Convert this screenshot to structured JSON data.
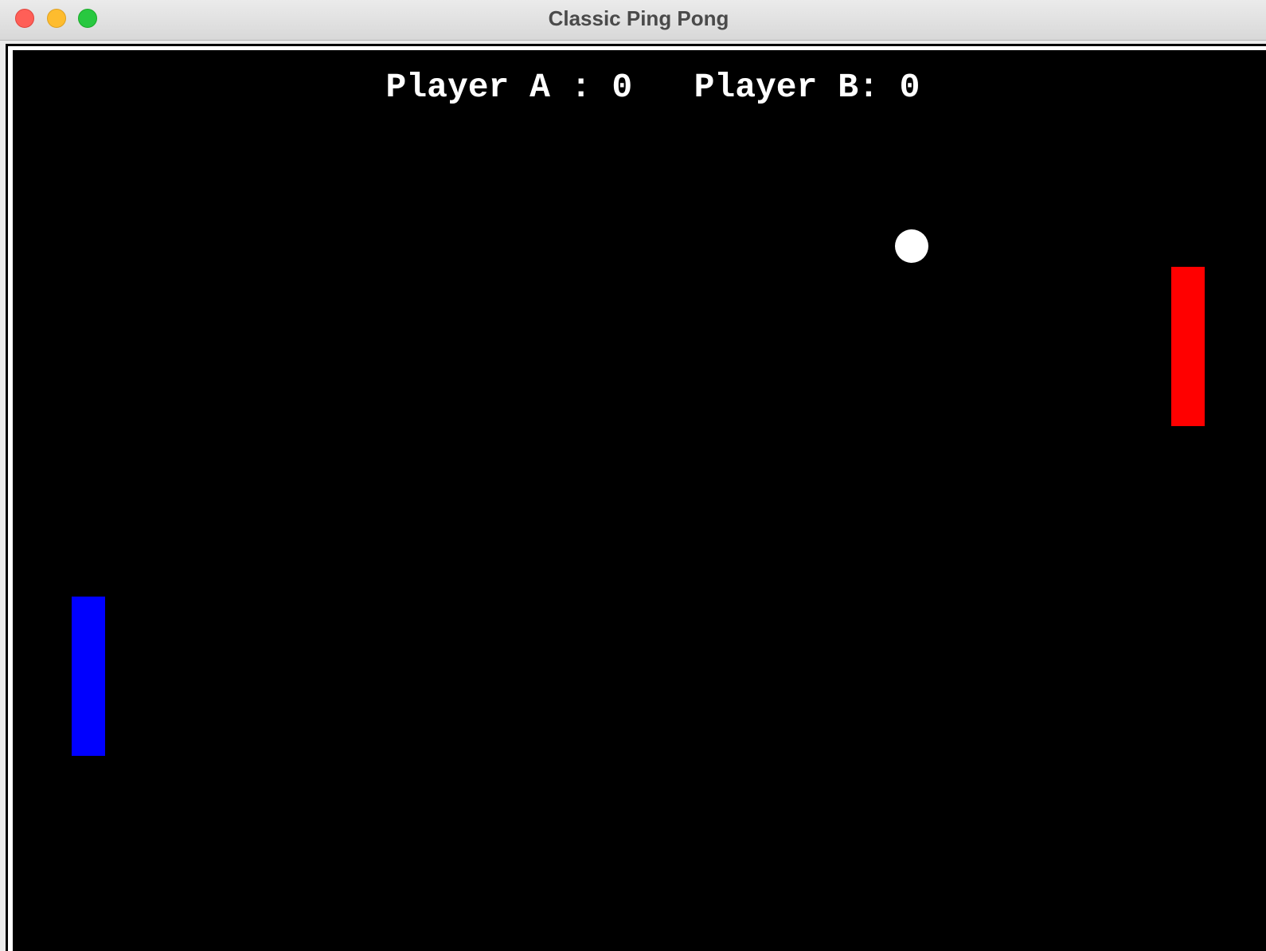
{
  "window": {
    "title": "Classic Ping Pong"
  },
  "scoreboard": {
    "text": "Player A : 0   Player B: 0",
    "player_a_score": 0,
    "player_b_score": 0
  },
  "colors": {
    "background": "#000000",
    "paddle_a": "#0000ff",
    "paddle_b": "#ff0000",
    "ball": "#ffffff",
    "score_text": "#ffffff"
  }
}
